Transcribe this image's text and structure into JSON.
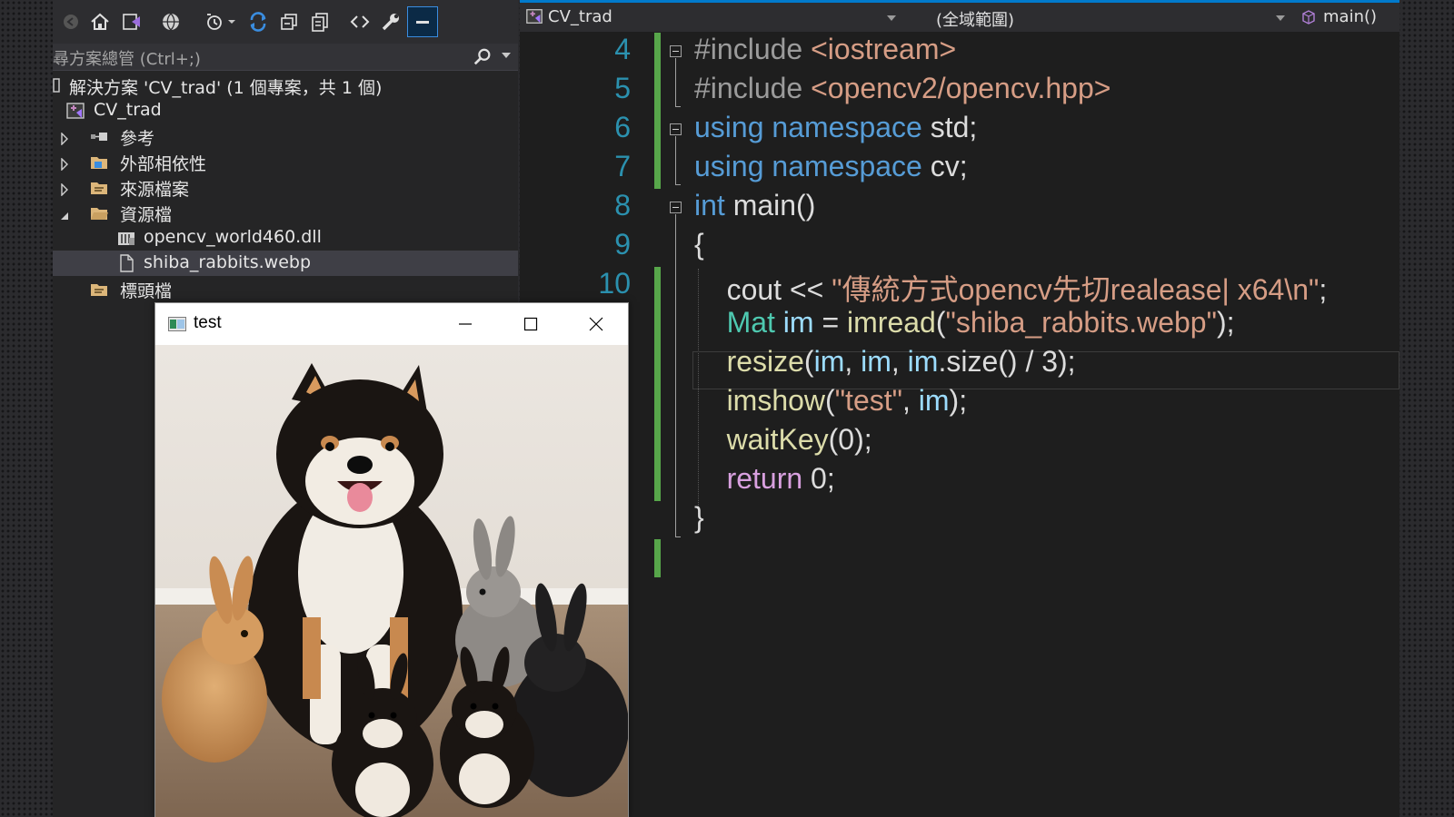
{
  "explorer": {
    "search_placeholder": "尋方案總管 (Ctrl+;)",
    "solution_label": "解決方案 'CV_trad' (1 個專案，共 1 個)",
    "project_label": "CV_trad",
    "items": [
      {
        "label": "參考",
        "icon": "references-icon"
      },
      {
        "label": "外部相依性",
        "icon": "folder-icon"
      },
      {
        "label": "來源檔案",
        "icon": "folder-icon"
      },
      {
        "label": "資源檔",
        "icon": "folder-icon"
      },
      {
        "label": "opencv_world460.dll",
        "icon": "dll-icon"
      },
      {
        "label": "shiba_rabbits.webp",
        "icon": "file-icon"
      },
      {
        "label": "標頭檔",
        "icon": "folder-icon"
      }
    ]
  },
  "editor": {
    "nav": {
      "project": "CV_trad",
      "scope": "(全域範圍)",
      "member": "main()"
    },
    "line_numbers": [
      "4",
      "5",
      "6",
      "7",
      "8",
      "9",
      "10"
    ],
    "code": {
      "l4a": "#include ",
      "l4b": "<iostream>",
      "l5a": "#include ",
      "l5b": "<opencv2/opencv.hpp>",
      "l6a": "using namespace",
      "l6b": " std;",
      "l7a": "using namespace",
      "l7b": " cv;",
      "l8a": "int",
      "l8b": " main()",
      "l9": "{",
      "l10a": "    cout << ",
      "l10b": "\"傳統方式opencv先切realease| x64\\n\"",
      "l10c": ";",
      "l11a": "    ",
      "l11b": "Mat",
      "l11c": " im",
      "l11d": " = ",
      "l11e": "imread",
      "l11f": "(",
      "l11g": "\"shiba_rabbits.webp\"",
      "l11h": ");",
      "l12a": "    ",
      "l12b": "resize",
      "l12c": "(",
      "l12d": "im",
      "l12e": ", ",
      "l12f": "im",
      "l12g": ", ",
      "l12h": "im",
      "l12i": ".size() / 3);",
      "l13a": "    ",
      "l13b": "imshow",
      "l13c": "(",
      "l13d": "\"test\"",
      "l13e": ", ",
      "l13f": "im",
      "l13g": ");",
      "l14a": "    ",
      "l14b": "waitKey",
      "l14c": "(0);",
      "l15a": "    ",
      "l15b": "return",
      "l15c": " 0;",
      "l16": "}"
    }
  },
  "image_window": {
    "title": "test",
    "image_description_icon": "shiba-with-rabbits-image"
  }
}
